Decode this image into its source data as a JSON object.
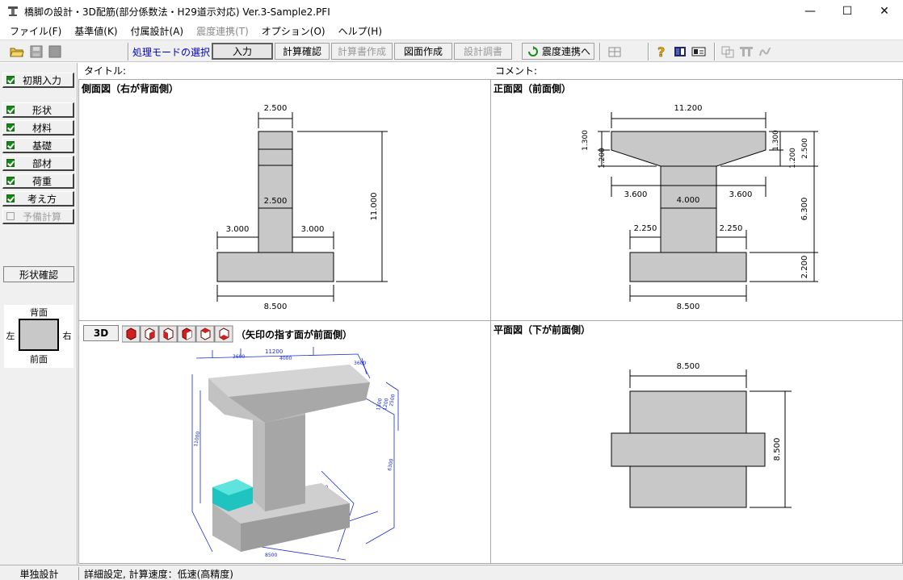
{
  "window": {
    "title": "橋脚の設計・3D配筋(部分係数法・H29道示対応) Ver.3-Sample2.PFI",
    "minimize": "—",
    "maximize": "☐",
    "close": "✕"
  },
  "menu": [
    "ファイル(F)",
    "基準値(K)",
    "付属設計(A)",
    "震度連携(T)",
    "オプション(O)",
    "ヘルプ(H)"
  ],
  "toolbar": {
    "mode_label": "処理モードの選択",
    "buttons": [
      "入力",
      "計算確認",
      "計算書作成",
      "図面作成",
      "設計調書",
      "震度連携へ"
    ]
  },
  "left_panel": {
    "items": [
      "初期入力",
      "形状",
      "材料",
      "基礎",
      "部材",
      "荷重",
      "考え方",
      "予備計算"
    ],
    "shape_check": "形状確認",
    "orientation": {
      "back": "背面",
      "front": "前面",
      "left": "左",
      "right": "右"
    }
  },
  "labels": {
    "title": "タイトル:",
    "comment": "コメント:"
  },
  "side_view": {
    "title": "側面図（右が背面側）",
    "dims": {
      "top": "2.500",
      "mid": "2.500",
      "left": "3.000",
      "right": "3.000",
      "height": "11.000",
      "bottom": "8.500"
    }
  },
  "front_view": {
    "title": "正面図（前面側）",
    "dims": {
      "top": "11.200",
      "h1": "1.300",
      "h2": "1.200",
      "h3": "1.300",
      "h4": "1.200",
      "h5": "2.500",
      "left": "3.600",
      "mid": "4.000",
      "right": "3.600",
      "inner_left": "2.250",
      "inner_right": "2.250",
      "col": "6.300",
      "footing": "2.200",
      "bottom": "8.500"
    }
  },
  "view3d": {
    "btn": "3D",
    "note": "（矢印の指す面が前面側）",
    "dims": {
      "w": "11200",
      "l1": "3600",
      "l2": "4000",
      "l3": "3600",
      "h": "1300",
      "h2": "1200",
      "h3": "2500",
      "v": "11000",
      "v2": "6300",
      "f": "8500",
      "c": "2250"
    }
  },
  "plan_view": {
    "title": "平面図（下が前面側）",
    "dims": {
      "top": "8.500",
      "right": "8.500"
    }
  },
  "status": {
    "mode": "単独設計",
    "detail": "詳細設定, 計算速度：低速(高精度)"
  }
}
